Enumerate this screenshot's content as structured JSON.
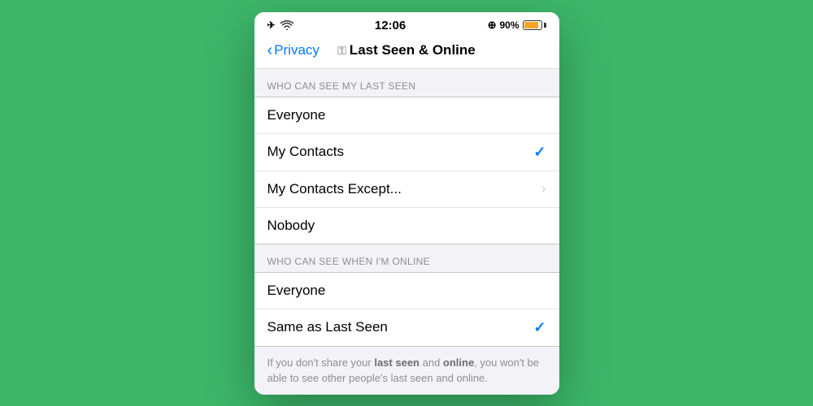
{
  "statusBar": {
    "left": {
      "airplane": "✈",
      "wifi": "wifi"
    },
    "time": "12:06",
    "right": {
      "location": "@",
      "battery_pct": "90%"
    }
  },
  "navBar": {
    "back_label": "Privacy",
    "title": "Last Seen & Online"
  },
  "sections": [
    {
      "header": "WHO CAN SEE MY LAST SEEN",
      "rows": [
        {
          "label": "Everyone",
          "checked": false,
          "hasChevron": false
        },
        {
          "label": "My Contacts",
          "checked": true,
          "hasChevron": false
        },
        {
          "label": "My Contacts Except...",
          "checked": false,
          "hasChevron": true
        },
        {
          "label": "Nobody",
          "checked": false,
          "hasChevron": false
        }
      ]
    },
    {
      "header": "WHO CAN SEE WHEN I'M ONLINE",
      "rows": [
        {
          "label": "Everyone",
          "checked": false,
          "hasChevron": false
        },
        {
          "label": "Same as Last Seen",
          "checked": true,
          "hasChevron": false
        }
      ]
    }
  ],
  "infoText": "If you don't share your last seen and online, you won't be able to see other people's last seen and online.",
  "infoTextBold1": "last seen",
  "infoTextBold2": "online"
}
